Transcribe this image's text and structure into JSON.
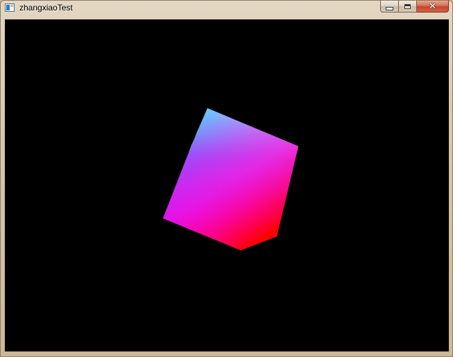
{
  "window": {
    "title": "zhangxiaoTest"
  },
  "controls": {
    "minimize": "minimize-button",
    "maximize": "maximize-button",
    "close": "close-button"
  },
  "scene": {
    "background": "#000000",
    "object": "rgb-color-cube",
    "face_colors": {
      "cyan": "#00ffff",
      "white": "#ffffff",
      "blue": "#0000ff",
      "magenta": "#ff00ff",
      "red": "#ff0000",
      "green": "#00ff00",
      "black": "#000000"
    }
  }
}
